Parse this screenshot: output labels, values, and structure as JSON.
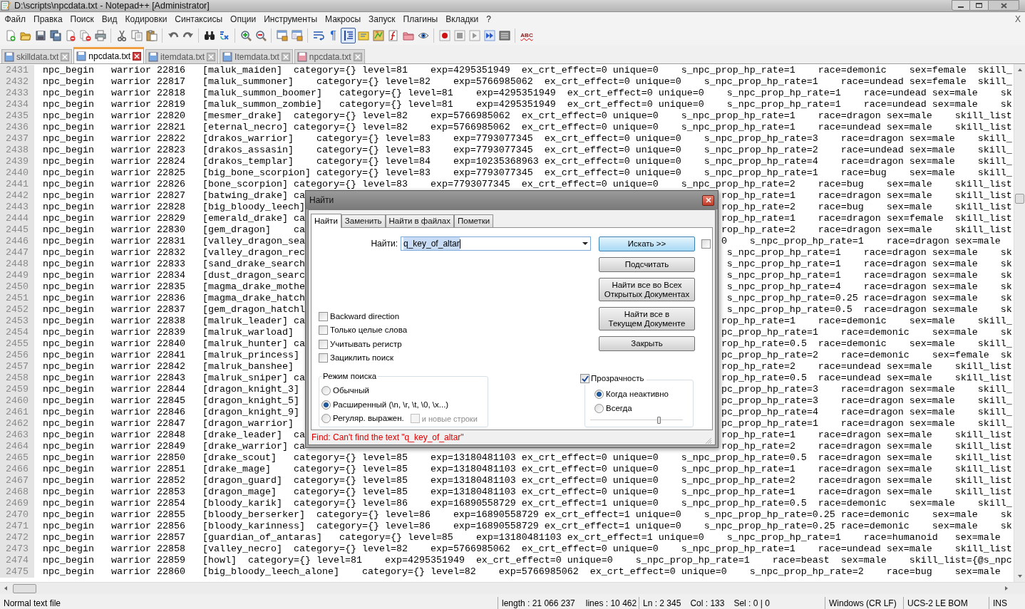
{
  "window": {
    "title": "D:\\scripts\\npcdata.txt - Notepad++ [Administrator]"
  },
  "menu": [
    "Файл",
    "Правка",
    "Поиск",
    "Вид",
    "Кодировки",
    "Синтаксисы",
    "Опции",
    "Инструменты",
    "Макросы",
    "Запуск",
    "Плагины",
    "Вкладки",
    "?"
  ],
  "menu_close": "X",
  "toolbar": {
    "pilcrow": "¶",
    "spellcheck": "ABC"
  },
  "tabs": [
    {
      "label": "skilldata.txt",
      "selected": false,
      "unsaved": false
    },
    {
      "label": "npcdata.txt",
      "selected": true,
      "unsaved": false
    },
    {
      "label": "itemdata.txt",
      "selected": false,
      "unsaved": false
    },
    {
      "label": "Itemdata.txt",
      "selected": false,
      "unsaved": false
    },
    {
      "label": "npcdata.txt",
      "selected": false,
      "unsaved": true
    }
  ],
  "editor": {
    "lines": [
      {
        "kind": "full",
        "number": "2431",
        "text": "npc_begin\twarrior 22816\t[maluk_maiden]\tcategory={} level=81\texp=4295351949\tex_crt_effect=0 unique=0\ts_npc_prop_hp_rate=1\trace=demonic\tsex=female\tskill_"
      },
      {
        "kind": "full",
        "number": "2432",
        "text": "npc_begin\twarrior 22817\t[maluk_summoner]\tcategory={} level=82\texp=5766985062\tex_crt_effect=0 unique=0\ts_npc_prop_hp_rate=1\trace=undead\tsex=female\tskill_"
      },
      {
        "kind": "full",
        "number": "2433",
        "text": "npc_begin\twarrior 22818\t[maluk_summon_boomer]\tcategory={} level=81\texp=4295351949\tex_crt_effect=0 unique=0\ts_npc_prop_hp_rate=1\trace=undead\tsex=male\tsk"
      },
      {
        "kind": "full",
        "number": "2434",
        "text": "npc_begin\twarrior 22819\t[maluk_summon_zombie]\tcategory={} level=81\texp=4295351949\tex_crt_effect=0 unique=0\ts_npc_prop_hp_rate=1\trace=undead\tsex=male\tsk"
      },
      {
        "kind": "full",
        "number": "2435",
        "text": "npc_begin\twarrior 22820\t[mesmer_drake]\tcategory={} level=82\texp=5766985062\tex_crt_effect=0 unique=0\ts_npc_prop_hp_rate=1\trace=dragon\tsex=male\tskill_list"
      },
      {
        "kind": "full",
        "number": "2436",
        "text": "npc_begin\twarrior 22821\t[eternal_necro]\tcategory={} level=82\texp=5766985062\tex_crt_effect=0 unique=0\ts_npc_prop_hp_rate=1\trace=undead\tsex=male\tskill_list"
      },
      {
        "kind": "full",
        "number": "2437",
        "text": "npc_begin\twarrior 22822\t[drakos_warrior]\tcategory={} level=83\texp=7793077345\tex_crt_effect=0 unique=0\ts_npc_prop_hp_rate=3\trace=dragon\tsex=male\tskill_"
      },
      {
        "kind": "full",
        "number": "2438",
        "text": "npc_begin\twarrior 22823\t[drakos_assasin]\tcategory={} level=83\texp=7793077345\tex_crt_effect=0 unique=0\ts_npc_prop_hp_rate=2\trace=undead\tsex=male\tskill_"
      },
      {
        "kind": "full",
        "number": "2439",
        "text": "npc_begin\twarrior 22824\t[drakos_templar]\tcategory={} level=84\texp=10235368963\tex_crt_effect=0 unique=0\ts_npc_prop_hp_rate=4\trace=dragon\tsex=male\tskill_"
      },
      {
        "kind": "full",
        "number": "2440",
        "text": "npc_begin\twarrior 22825\t[big_bone_scorpion]\tcategory={} level=83\texp=7793077345\tex_crt_effect=0 unique=0\ts_npc_prop_hp_rate=1\trace=bug\tsex=male\tskill_"
      },
      {
        "kind": "full",
        "number": "2441",
        "text": "npc_begin\twarrior 22826\t[bone_scorpion]\tcategory={} level=83\texp=7793077345\tex_crt_effect=0 unique=0\ts_npc_prop_hp_rate=2\trace=bug\tsex=male\tskill_list"
      },
      {
        "kind": "split",
        "number": "2442",
        "left": "npc_begin\twarrior 22827\t[batwing_drake]\tca",
        "right": "rop_hp_rate=1\trace=dragon\tsex=male\tskill_list"
      },
      {
        "kind": "split",
        "number": "2443",
        "left": "npc_begin\twarrior 22828\t[big_bloody_leech]",
        "right": "rop_hp_rate=2\trace=bug\tsex=male\tskill_list"
      },
      {
        "kind": "split",
        "number": "2444",
        "left": "npc_begin\twarrior 22829\t[emerald_drake]\tca",
        "right": "rop_hp_rate=1\trace=dragon\tsex=female\tskill_list"
      },
      {
        "kind": "split",
        "number": "2445",
        "left": "npc_begin\twarrior 22830\t[gem_dragon]\tca",
        "right": "rop_hp_rate=2\trace=dragon\tsex=male\tskill_list"
      },
      {
        "kind": "split",
        "number": "2446",
        "left": "npc_begin\twarrior 22831\t[valley_dragon_sea",
        "right": "0\ts_npc_prop_hp_rate=1\trace=dragon\tsex=male"
      },
      {
        "kind": "split",
        "number": "2447",
        "left": "npc_begin\twarrior 22832\t[valley_dragon_rec",
        "right": "\ts_npc_prop_hp_rate=1\trace=dragon\tsex=male\tsk"
      },
      {
        "kind": "split",
        "number": "2448",
        "left": "npc_begin\twarrior 22833\t[sand_drake_search",
        "right": "\ts_npc_prop_hp_rate=1\trace=dragon\tsex=male\tsk"
      },
      {
        "kind": "split",
        "number": "2449",
        "left": "npc_begin\twarrior 22834\t[dust_dragon_searc",
        "right": "\ts_npc_prop_hp_rate=1\trace=dragon\tsex=male\tsk"
      },
      {
        "kind": "split",
        "number": "2450",
        "left": "npc_begin\twarrior 22835\t[magma_drake_mothe",
        "right": "\ts_npc_prop_hp_rate=4\trace=dragon\tsex=male\tsk"
      },
      {
        "kind": "split",
        "number": "2451",
        "left": "npc_begin\twarrior 22836\t[magma_drake_hatch",
        "right": "\ts_npc_prop_hp_rate=0.25\trace=dragon\tsex=male\tsk"
      },
      {
        "kind": "split",
        "number": "2452",
        "left": "npc_begin\twarrior 22837\t[gem_dragon_hatchl",
        "right": "\ts_npc_prop_hp_rate=0.5\trace=dragon\tsex=male\tsk"
      },
      {
        "kind": "split",
        "number": "2453",
        "left": "npc_begin\twarrior 22838\t[malruk_leader]\tca",
        "right": "rop_hp_rate=1\trace=demonic\tsex=male\tskill_"
      },
      {
        "kind": "split",
        "number": "2454",
        "left": "npc_begin\twarrior 22839\t[malruk_warload]",
        "right": "pc_prop_hp_rate=1\trace=demonic\tsex=male\tsk"
      },
      {
        "kind": "split",
        "number": "2455",
        "left": "npc_begin\twarrior 22840\t[malruk_hunter]\tca",
        "right": "rop_hp_rate=0.5\trace=demonic\tsex=male\tskill_"
      },
      {
        "kind": "split",
        "number": "2456",
        "left": "npc_begin\twarrior 22841\t[malruk_princess]",
        "right": "pc_prop_hp_rate=2\trace=demonic\tsex=female\tsk"
      },
      {
        "kind": "split",
        "number": "2457",
        "left": "npc_begin\twarrior 22842\t[malruk_banshee]",
        "right": "rop_hp_rate=2\trace=undead\tsex=male\tskill_list"
      },
      {
        "kind": "split",
        "number": "2458",
        "left": "npc_begin\twarrior 22843\t[malruk_sniper]\tca",
        "right": "rop_hp_rate=0.5\trace=undead\tsex=male\tskill_list"
      },
      {
        "kind": "split",
        "number": "2459",
        "left": "npc_begin\twarrior 22844\t[dragon_knight_3]",
        "right": "pc_prop_hp_rate=3\trace=dragon\tsex=male\tskill_"
      },
      {
        "kind": "split",
        "number": "2460",
        "left": "npc_begin\twarrior 22845\t[dragon_knight_5]",
        "right": "pc_prop_hp_rate=3\trace=dragon\tsex=male\tskill_"
      },
      {
        "kind": "split",
        "number": "2461",
        "left": "npc_begin\twarrior 22846\t[dragon_knight_9]",
        "right": "pc_prop_hp_rate=4\trace=dragon\tsex=male\tskill_"
      },
      {
        "kind": "split",
        "number": "2462",
        "left": "npc_begin\twarrior 22847\t[dragon_warrior]",
        "right": "pc_prop_hp_rate=1\trace=dragon\tsex=male\tskill_"
      },
      {
        "kind": "split",
        "number": "2463",
        "left": "npc_begin\twarrior 22848\t[drake_leader]\tca",
        "right": "rop_hp_rate=1\trace=dragon\tsex=male\tskill_list"
      },
      {
        "kind": "split",
        "number": "2464",
        "left": "npc_begin\twarrior 22849\t[drake_warrior]\tca",
        "right": "rop_hp_rate=2\trace=dragon\tsex=male\tskill_list"
      },
      {
        "kind": "full",
        "number": "2465",
        "text": "npc_begin\twarrior 22850\t[drake_scout]\tcategory={} level=85\texp=13180481103\tex_crt_effect=0 unique=0\ts_npc_prop_hp_rate=0.5\trace=dragon\tsex=male\tskill_list"
      },
      {
        "kind": "full",
        "number": "2466",
        "text": "npc_begin\twarrior 22851\t[drake_mage]\tcategory={} level=85\texp=13180481103\tex_crt_effect=0 unique=0\ts_npc_prop_hp_rate=1\trace=dragon\tsex=male\tskill_list"
      },
      {
        "kind": "full",
        "number": "2467",
        "text": "npc_begin\twarrior 22852\t[dragon_guard]\tcategory={} level=85\texp=13180481103\tex_crt_effect=0 unique=0\ts_npc_prop_hp_rate=2\trace=dragon\tsex=male\tskill_list"
      },
      {
        "kind": "full",
        "number": "2468",
        "text": "npc_begin\twarrior 22853\t[dragon_mage]\tcategory={} level=85\texp=13180481103\tex_crt_effect=0 unique=0\ts_npc_prop_hp_rate=1\trace=dragon\tsex=male\tskill_list"
      },
      {
        "kind": "full",
        "number": "2469",
        "text": "npc_begin\twarrior 22854\t[bloody_karik]\tcategory={} level=86\texp=16890558729\tex_crt_effect=1 unique=0\ts_npc_prop_hp_rate=0.5\trace=demonic\tsex=male\tskill_"
      },
      {
        "kind": "full",
        "number": "2470",
        "text": "npc_begin\twarrior 22855\t[bloody_berserker]\tcategory={} level=86\texp=16890558729\tex_crt_effect=1 unique=0\ts_npc_prop_hp_rate=0.25\trace=demonic\tsex=male\tsk"
      },
      {
        "kind": "full",
        "number": "2471",
        "text": "npc_begin\twarrior 22856\t[bloody_karinness]\tcategory={} level=86\texp=16890558729\tex_crt_effect=1 unique=0\ts_npc_prop_hp_rate=0.25\trace=demonic\tsex=male\tsk"
      },
      {
        "kind": "full",
        "number": "2472",
        "text": "npc_begin\twarrior 22857\t[guardian_of_antaras]\tcategory={} level=85\texp=13180481103\tex_crt_effect=1 unique=0\ts_npc_prop_hp_rate=1\trace=humanoid\tsex=male"
      },
      {
        "kind": "full",
        "number": "2473",
        "text": "npc_begin\twarrior 22858\t[valley_necro]\tcategory={} level=82\texp=5766985062\tex_crt_effect=0 unique=0\ts_npc_prop_hp_rate=1\trace=undead\tsex=male\tskill_list"
      },
      {
        "kind": "full",
        "number": "2474",
        "text": "npc_begin\twarrior 22859\t[howl]\tcategory={} level=81\texp=4295351949\tex_crt_effect=0 unique=0\ts_npc_prop_hp_rate=1\trace=beast\tsex=male\tskill_list={@s_npc"
      },
      {
        "kind": "full",
        "number": "2475",
        "text": "npc_begin\twarrior 22860\t[big_bloody_leech_alone]\tcategory={} level=82\texp=5766985062\tex_crt_effect=0 unique=0\ts_npc_prop_hp_rate=2\trace=bug\tsex=male"
      }
    ]
  },
  "find_dialog": {
    "title": "Найти",
    "tabs": [
      {
        "label": "Найти",
        "selected": true
      },
      {
        "label": "Заменить",
        "selected": false
      },
      {
        "label": "Найти в файлах",
        "selected": false
      },
      {
        "label": "Пометки",
        "selected": false
      }
    ],
    "find_label": "Найти:",
    "find_value": "q_key_of_altar",
    "buttons": [
      {
        "lines": [
          "Искать >>"
        ],
        "default": true
      },
      {
        "lines": [
          "Подсчитать"
        ],
        "default": false
      },
      {
        "lines": [
          "Найти все во Всех",
          "Открытых Документах"
        ],
        "default": false
      },
      {
        "lines": [
          "Найти все в",
          "Текущем Документе"
        ],
        "default": false
      },
      {
        "lines": [
          "Закрыть"
        ],
        "default": false
      }
    ],
    "side_checkbox": {
      "checked": false
    },
    "options": [
      {
        "label": "Backward direction",
        "checked": false
      },
      {
        "label": "Только целые слова",
        "checked": false
      },
      {
        "label": "Учитывать регистр",
        "checked": false
      },
      {
        "label": "Зациклить поиск",
        "checked": false
      }
    ],
    "search_mode": {
      "title": "Режим поиска",
      "options": [
        {
          "label": "Обычный",
          "selected": false
        },
        {
          "label": "Расширенный (\\n, \\r, \\t, \\0, \\x...)",
          "selected": true
        },
        {
          "label": "Регуляр. выражен.",
          "selected": false
        }
      ],
      "newline_option": {
        "label": "и новые строки",
        "checked": false,
        "disabled": true
      }
    },
    "transparency": {
      "label": "Прозрачность",
      "checked": true,
      "options": [
        {
          "label": "Когда неактивно",
          "selected": true
        },
        {
          "label": "Всегда",
          "selected": false
        }
      ],
      "level": 0.74
    },
    "status_message": "Find: Can't find the text \"q_key_of_altar\""
  },
  "status_bar": [
    {
      "items": [
        "Normal text file"
      ]
    },
    {
      "items": [
        "length : 21 066 237",
        "lines : 10 462"
      ]
    },
    {
      "items": [
        "Ln : 2 345",
        "Col : 133",
        "Sel : 0 | 0"
      ]
    },
    {
      "items": [
        "Windows (CR LF)"
      ]
    },
    {
      "items": [
        "UCS-2 LE BOM"
      ]
    },
    {
      "items": [
        "INS"
      ]
    }
  ]
}
